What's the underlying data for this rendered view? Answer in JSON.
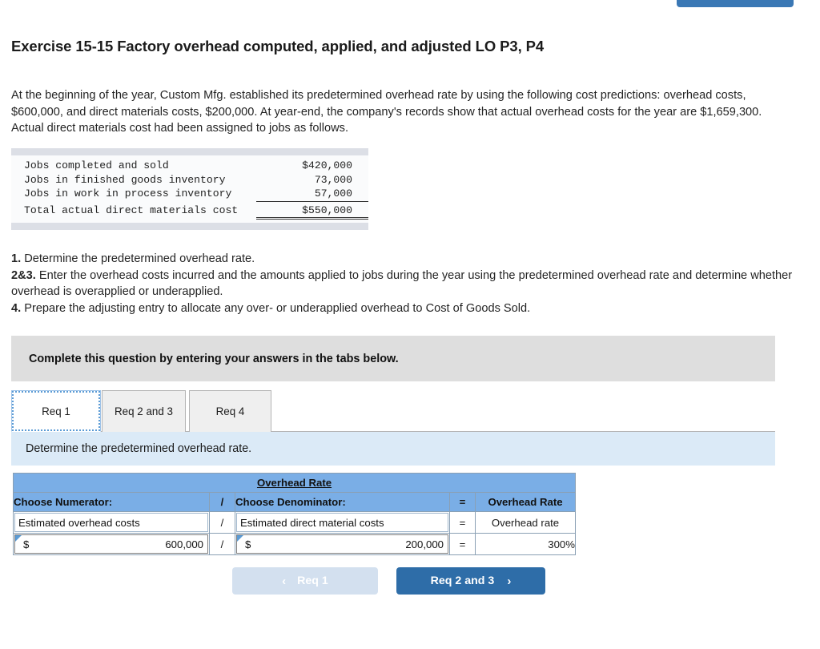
{
  "top": {
    "button_label": ""
  },
  "title": "Exercise 15-15 Factory overhead computed, applied, and adjusted LO P3, P4",
  "intro": "At the beginning of the year, Custom Mfg. established its predetermined overhead rate by using the following cost predictions: overhead costs, $600,000, and direct materials costs, $200,000. At year-end, the company's records show that actual overhead costs for the year are $1,659,300. Actual direct materials cost had been assigned to jobs as follows.",
  "cost_table": {
    "rows": [
      {
        "label": "Jobs completed and sold",
        "amount": "$420,000",
        "rule": "none"
      },
      {
        "label": "Jobs in finished goods inventory",
        "amount": "73,000",
        "rule": "none"
      },
      {
        "label": "Jobs in work in process inventory",
        "amount": "57,000",
        "rule": "single"
      }
    ],
    "total": {
      "label": "Total actual direct materials cost",
      "amount": "$550,000",
      "rule": "double"
    }
  },
  "requirements": [
    {
      "num": "1.",
      "text": " Determine the predetermined overhead rate."
    },
    {
      "num": "2&3.",
      "text": " Enter the overhead costs incurred and the amounts applied to jobs during the year using the predetermined overhead rate and determine whether overhead is overapplied or underapplied."
    },
    {
      "num": "4.",
      "text": " Prepare the adjusting entry to allocate any over- or underapplied overhead to Cost of Goods Sold."
    }
  ],
  "gray_banner": "Complete this question by entering your answers in the tabs below.",
  "tabs": [
    {
      "label": "Req 1",
      "active": true
    },
    {
      "label": "Req 2 and 3",
      "active": false
    },
    {
      "label": "Req 4",
      "active": false
    }
  ],
  "blue_banner": "Determine the predetermined overhead rate.",
  "answer_table": {
    "title": "Overhead Rate",
    "headers": {
      "numerator": "Choose Numerator:",
      "divider": "/",
      "denominator": "Choose Denominator:",
      "equals": "=",
      "result": "Overhead Rate"
    },
    "row_labels": {
      "numerator": "Estimated overhead costs",
      "divider": "/",
      "denominator": "Estimated direct material costs",
      "equals": "=",
      "result": "Overhead rate"
    },
    "row_values": {
      "numerator_symbol": "$",
      "numerator_value": "600,000",
      "divider": "/",
      "denominator_symbol": "$",
      "denominator_value": "200,000",
      "equals": "=",
      "result": "300%"
    }
  },
  "nav": {
    "prev_label": "Req 1",
    "prev_chevron": "‹",
    "next_label": "Req 2 and 3",
    "next_chevron": "›"
  },
  "colors": {
    "header_blue": "#7aaee6",
    "banner_blue": "#dbeaf7",
    "banner_gray": "#dedede",
    "button_blue": "#2e6da8",
    "button_disabled": "#d3e0ef",
    "accent_marker": "#5b9bd5"
  }
}
